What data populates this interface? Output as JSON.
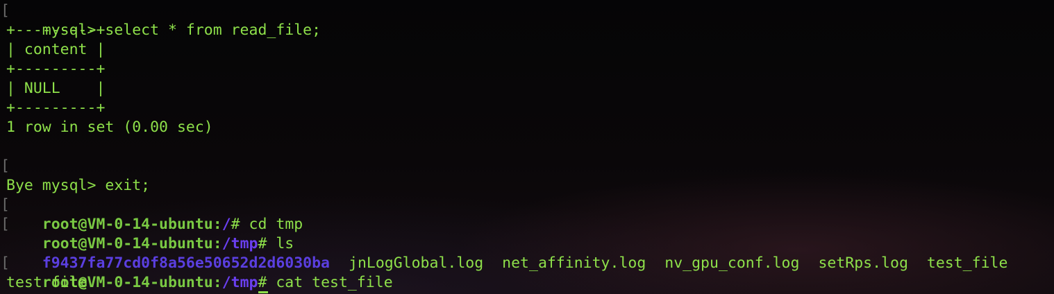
{
  "terminal": {
    "mysql_prompt_1": "mysql> ",
    "mysql_cmd_1": "select * from read_file;",
    "table_border": "+---------+",
    "table_header": "| content |",
    "table_row": "| NULL    |",
    "row_count": "1 row in set (0.00 sec)",
    "mysql_prompt_2": "mysql> ",
    "mysql_cmd_2": "exit;",
    "bye": "Bye",
    "shell_host": "root@VM-0-14-ubuntu",
    "colon": ":",
    "path_root": "/",
    "path_tmp": "/tmp",
    "hash": "#",
    "cmd_cd": " cd tmp",
    "cmd_ls": " ls",
    "cmd_cat": " cat test_file",
    "ls_entries": [
      "f9437fa77cd0f8a56e50652d2d6030ba",
      "jnLogGlobal.log",
      "net_affinity.log",
      "nv_gpu_conf.log",
      "setRps.log",
      "test_file"
    ],
    "cat_output": "test file",
    "margin_bracket": "["
  }
}
